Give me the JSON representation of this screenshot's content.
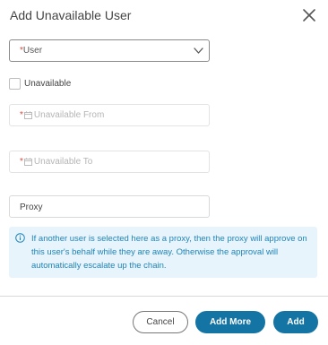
{
  "dialog": {
    "title": "Add Unavailable User",
    "close_icon": "close-icon"
  },
  "user_select": {
    "required_mark": "*",
    "label": "User",
    "icon": "chevron-down-icon"
  },
  "unavailable_checkbox": {
    "label": "Unavailable",
    "checked": false
  },
  "unavailable_from": {
    "required_mark": "*",
    "placeholder": "Unavailable From",
    "icon": "calendar-icon"
  },
  "unavailable_to": {
    "required_mark": "*",
    "placeholder": "Unavailable To",
    "icon": "calendar-icon"
  },
  "proxy": {
    "placeholder": "Proxy"
  },
  "info": {
    "icon": "info-icon",
    "text": "If another user is selected here as a proxy, then the proxy will approve on this user's behalf while they are away. Otherwise the approval will automatically escalate up the chain."
  },
  "footer": {
    "cancel_label": "Cancel",
    "add_more_label": "Add More",
    "add_label": "Add"
  },
  "colors": {
    "primary": "#1474a4",
    "required": "#e04a3f",
    "info_bg": "#e8f4fb",
    "info_text": "#1f84b8"
  }
}
